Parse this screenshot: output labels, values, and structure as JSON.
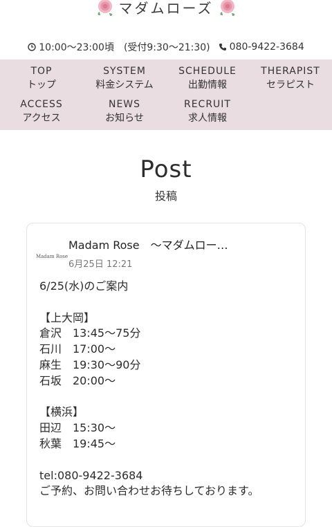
{
  "logo": {
    "text": "マダムローズ"
  },
  "contact": {
    "hours": "10:00〜23:00頃　(受付9:30〜21:30)",
    "phone": "080-9422-3684"
  },
  "nav": [
    {
      "en": "TOP",
      "jp": "トップ"
    },
    {
      "en": "SYSTEM",
      "jp": "料金システム"
    },
    {
      "en": "SCHEDULE",
      "jp": "出勤情報"
    },
    {
      "en": "THERAPIST",
      "jp": "セラピスト"
    },
    {
      "en": "ACCESS",
      "jp": "アクセス"
    },
    {
      "en": "NEWS",
      "jp": "お知らせ"
    },
    {
      "en": "RECRUIT",
      "jp": "求人情報"
    }
  ],
  "page": {
    "title": "Post",
    "subtitle": "投稿"
  },
  "post": {
    "avatar_text": "Madam Rose",
    "author": "Madam Rose　〜マダムロー…",
    "date": "6月25日 12:21",
    "lines": [
      "6/25(水)のご案内",
      "",
      "【上大岡】",
      "倉沢　13:45〜75分",
      "石川　17:00〜",
      "麻生　19:30〜90分",
      "石坂　20:00〜",
      "",
      "【横浜】",
      "田辺　15:30〜",
      "秋葉　19:45〜",
      "",
      "tel:080-9422-3684",
      "ご予約、お問い合わせお待ちしております。"
    ]
  },
  "colors": {
    "nav_bg": "#e9dde2",
    "rose": "#e8a1b2"
  },
  "icons": {
    "clock": "clock-icon",
    "phone": "phone-icon",
    "rose": "rose-icon"
  }
}
